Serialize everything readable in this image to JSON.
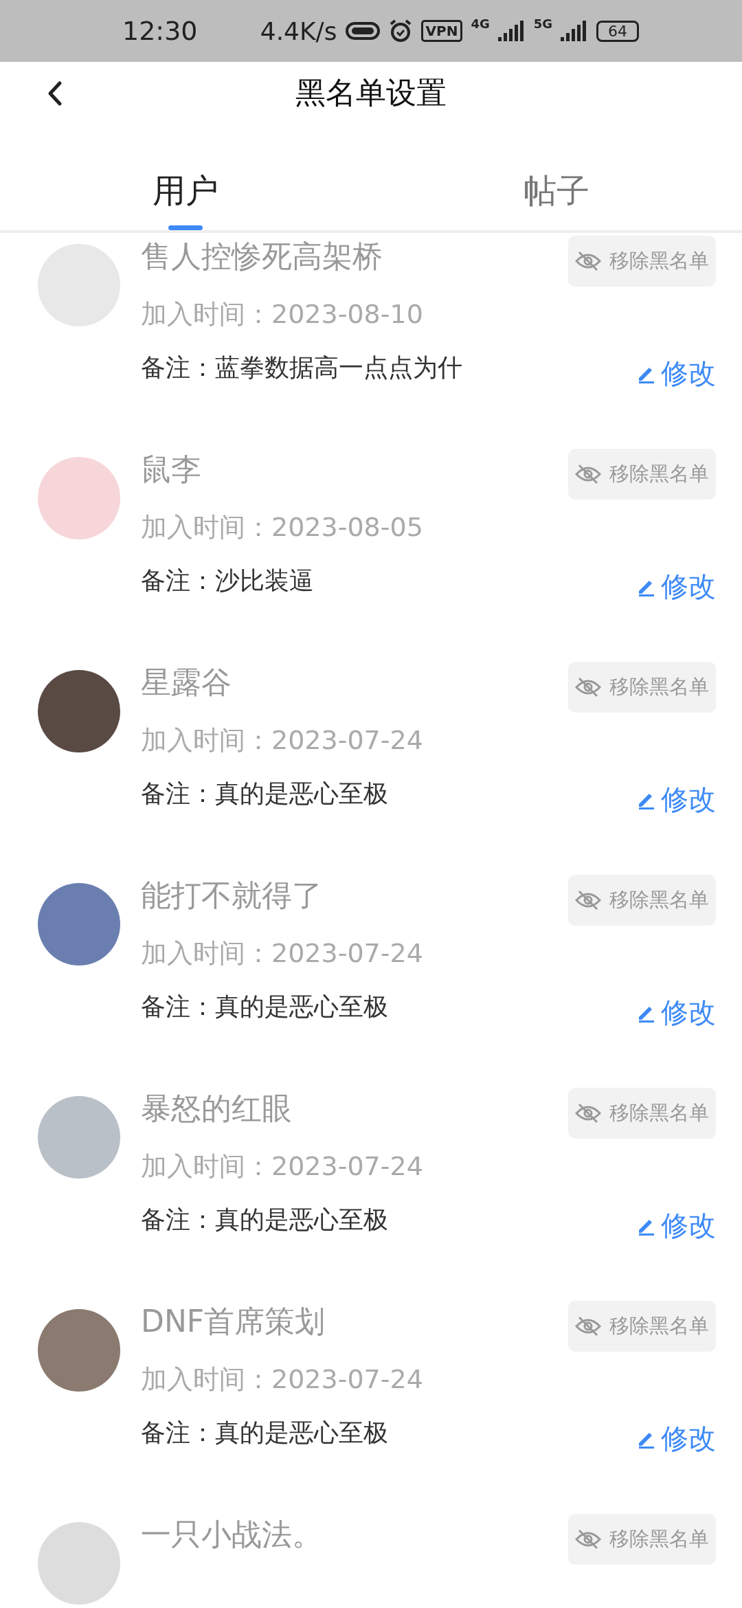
{
  "status_bar": {
    "time": "12:30",
    "net_speed": "4.4K/s",
    "vpn": "VPN",
    "signal_1": "4G",
    "signal_2": "5G",
    "battery": "64"
  },
  "header": {
    "title": "黑名单设置"
  },
  "tabs": [
    {
      "label": "用户",
      "selected": true
    },
    {
      "label": "帖子",
      "selected": false
    }
  ],
  "users": [
    {
      "name": "售人控惨死高架桥",
      "joined": "加入时间：2023-08-10",
      "note": "备注：蓝拳数据高一点点为什",
      "remove": "移除黑名单",
      "edit": "修改"
    },
    {
      "name": "鼠李",
      "joined": "加入时间：2023-08-05",
      "note": "备注：沙比装逼",
      "remove": "移除黑名单",
      "edit": "修改"
    },
    {
      "name": "星露谷",
      "joined": "加入时间：2023-07-24",
      "note": "备注：真的是恶心至极",
      "remove": "移除黑名单",
      "edit": "修改"
    },
    {
      "name": "能打不就得了",
      "joined": "加入时间：2023-07-24",
      "note": "备注：真的是恶心至极",
      "remove": "移除黑名单",
      "edit": "修改"
    },
    {
      "name": "暴怒的红眼",
      "joined": "加入时间：2023-07-24",
      "note": "备注：真的是恶心至极",
      "remove": "移除黑名单",
      "edit": "修改"
    },
    {
      "name": "DNF首席策划",
      "joined": "加入时间：2023-07-24",
      "note": "备注：真的是恶心至极",
      "remove": "移除黑名单",
      "edit": "修改"
    },
    {
      "name": "一只小战法。",
      "remove": "移除黑名单"
    }
  ]
}
